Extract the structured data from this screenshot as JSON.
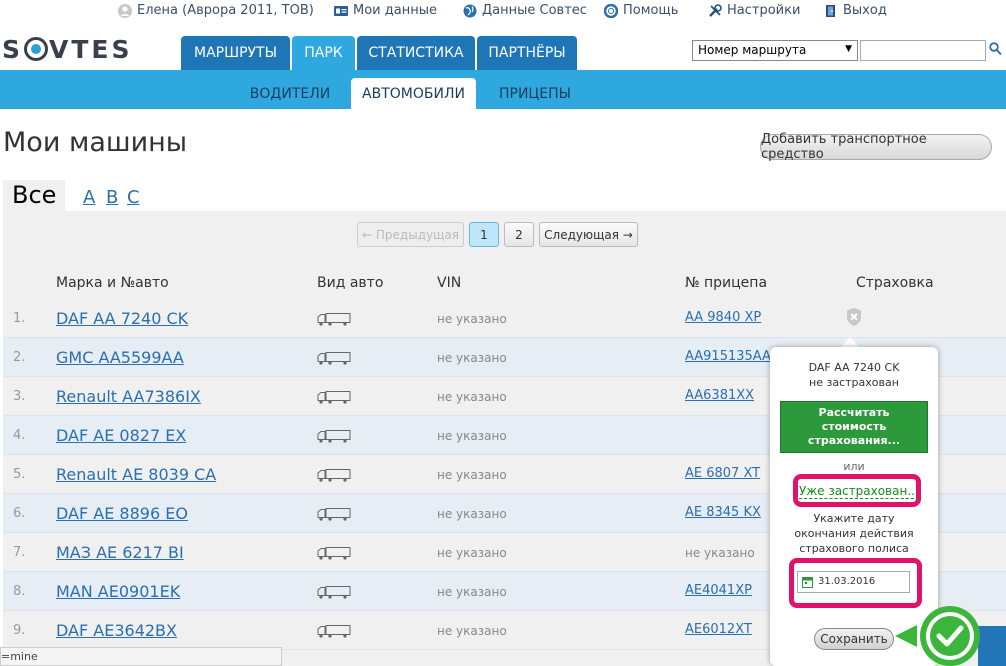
{
  "topbar": {
    "user": "Елена (Аврора 2011, ТОВ)",
    "my_data": "Мои данные",
    "sovtes_data": "Данные Совтес",
    "help": "Помощь",
    "settings": "Настройки",
    "logout": "Выход"
  },
  "header": {
    "logo": "SOVTES",
    "tabs": [
      {
        "label": "МАРШРУТЫ",
        "active": false
      },
      {
        "label": "ПАРК",
        "active": true
      },
      {
        "label": "СТАТИСТИКА",
        "active": false
      },
      {
        "label": "ПАРТНЁРЫ",
        "active": false
      }
    ],
    "route_select": "Номер маршрута",
    "search_value": ""
  },
  "subnav": [
    {
      "label": "ВОДИТЕЛИ",
      "active": false
    },
    {
      "label": "АВТОМОБИЛИ",
      "active": true
    },
    {
      "label": "ПРИЦЕПЫ",
      "active": false
    }
  ],
  "page": {
    "title": "Мои машины",
    "add_button": "Добавить транспортное средство",
    "filter_all": "Все",
    "letters": [
      "A",
      "B",
      "C"
    ]
  },
  "pagination": {
    "prev": "← Предыдущая",
    "pages": [
      "1",
      "2"
    ],
    "current": "1",
    "next": "Следующая →"
  },
  "table": {
    "columns": [
      "Марка и №авто",
      "Вид авто",
      "VIN",
      "№ прицепа",
      "Страховка"
    ],
    "rows": [
      {
        "num": "1.",
        "model": "DAF AA 7240 CK",
        "vin": "не указано",
        "trailer": "AA 9840 XP"
      },
      {
        "num": "2.",
        "model": "GMC AA5599AA",
        "vin": "не указано",
        "trailer": "AA915135AA"
      },
      {
        "num": "3.",
        "model": "Renault AA7386IX",
        "vin": "не указано",
        "trailer": "AA6381XX"
      },
      {
        "num": "4.",
        "model": "DAF AE 0827 EX",
        "vin": "не указано",
        "trailer": ""
      },
      {
        "num": "5.",
        "model": "Renault AE 8039 CA",
        "vin": "не указано",
        "trailer": "AE 6807 XT"
      },
      {
        "num": "6.",
        "model": "DAF AE 8896 EO",
        "vin": "не указано",
        "trailer": "AE 8345 KX"
      },
      {
        "num": "7.",
        "model": "МАЗ AE 6217 BI",
        "vin": "не указано",
        "trailer": "не указано"
      },
      {
        "num": "8.",
        "model": "MAN AE0901EK",
        "vin": "не указано",
        "trailer": "AE4041XP"
      },
      {
        "num": "9.",
        "model": "DAF AE3642BX",
        "vin": "не указано",
        "trailer": "AE6012XT"
      }
    ]
  },
  "popup": {
    "car": "DAF AA 7240 CK",
    "status": "не застрахован",
    "calc_button": "Рассчитать стоимость страхования...",
    "or": "или",
    "already_link": "Уже застрахован...",
    "instruction": "Укажите дату окончания действия страхового полиса",
    "date_value": "31.03.2016",
    "save_button": "Сохранить"
  },
  "status_bar": "=mine",
  "colors": {
    "tab_blue": "#1e76b6",
    "tab_active": "#2fa8e0",
    "link_blue": "#2a6fb0",
    "green_button": "#2c9a3a",
    "highlight_pink": "#e0126a",
    "check_green": "#3cb53c"
  }
}
